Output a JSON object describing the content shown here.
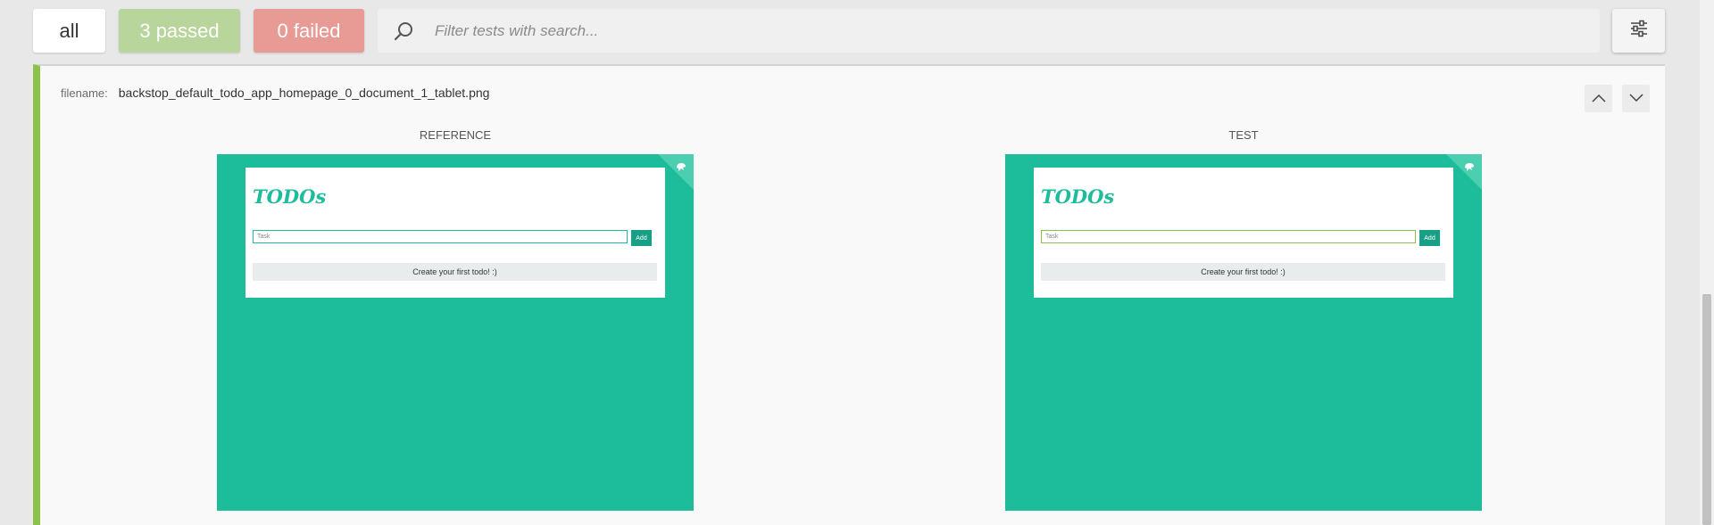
{
  "toolbar": {
    "all_label": "all",
    "passed_label": "3 passed",
    "failed_label": "0 failed",
    "search_placeholder": "Filter tests with search...",
    "icons": {
      "search": "search-icon",
      "settings": "settings-sliders-icon"
    }
  },
  "test": {
    "filename_label": "filename:",
    "filename": "backstop_default_todo_app_homepage_0_document_1_tablet.png",
    "columns": [
      {
        "label": "REFERENCE"
      },
      {
        "label": "TEST"
      }
    ]
  },
  "app_preview": {
    "title": "TODOs",
    "input_placeholder": "Task",
    "add_label": "Add",
    "empty_message": "Create your first todo! :)"
  },
  "colors": {
    "passed": "#b8d69c",
    "failed": "#e89a95",
    "accent": "#1dbc9b",
    "card_border": "#8bc34a"
  }
}
